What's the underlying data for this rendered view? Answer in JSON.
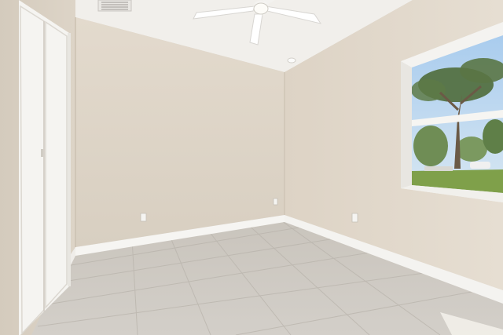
{
  "scene": {
    "subject": "empty-bedroom",
    "objects": [
      "ceiling-fan",
      "air-vent",
      "closet-bifold-door",
      "window",
      "tile-floor",
      "baseboard",
      "electrical-outlet",
      "recessed-light"
    ],
    "colors": {
      "wall": "#e2d9cc",
      "wall_shadow": "#d2c8b8",
      "ceiling": "#f2f0ec",
      "floor": "#cdc9c2",
      "trim": "#f7f6f3",
      "sky": "#bcd7f0",
      "lawn": "#7fa04a",
      "tree": "#4f6b3a"
    }
  }
}
